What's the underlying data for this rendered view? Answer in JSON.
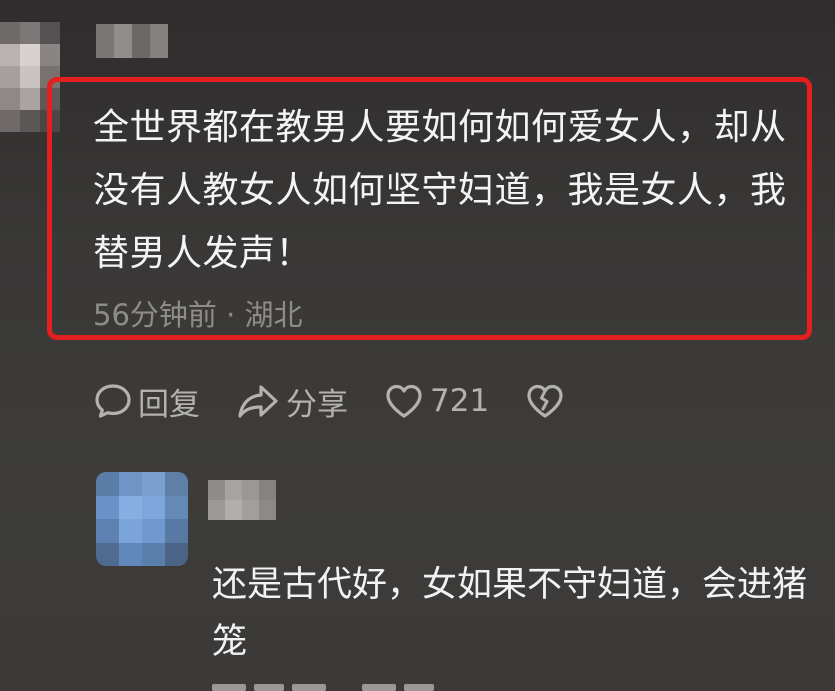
{
  "comment": {
    "text": "全世界都在教男人要如何如何爱女人，却从没有人教女人如何坚守妇道，我是女人，我替男人发声！",
    "meta": "56分钟前 · 湖北"
  },
  "actions": {
    "reply_label": "回复",
    "share_label": "分享",
    "like_count": "721"
  },
  "reply": {
    "text": "还是古代好，女如果不守妇道，会进猪笼"
  },
  "colors": {
    "highlight_border": "#e31f1f",
    "meta_text": "#8d8c8a",
    "action_text": "#b3b2b0"
  },
  "icons": [
    "comment-bubble-icon",
    "share-arrow-icon",
    "heart-icon",
    "broken-heart-icon"
  ]
}
